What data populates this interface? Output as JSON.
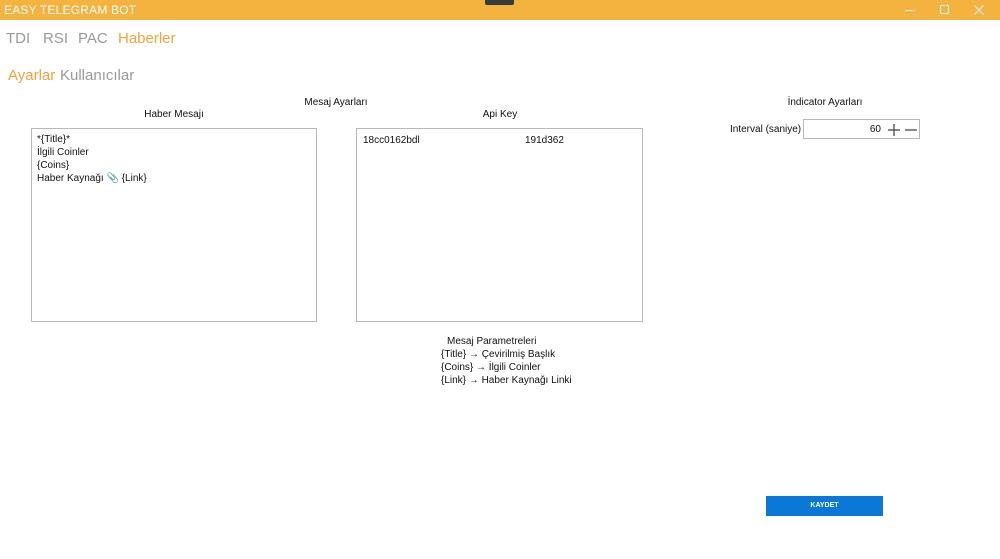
{
  "window": {
    "title": "EASY TELEGRAM BOT",
    "accent": "#f3b33e",
    "active_tab_color": "#f0a43a"
  },
  "tabs": [
    {
      "label": "TDI",
      "active": false
    },
    {
      "label": "RSI",
      "active": false
    },
    {
      "label": "PAC",
      "active": false
    },
    {
      "label": "Haberler",
      "active": true
    }
  ],
  "subtabs": [
    {
      "label": "Ayarlar",
      "active": true
    },
    {
      "label": "Kullanıcılar",
      "active": false
    }
  ],
  "message_settings": {
    "section_title": "Mesaj Ayarları",
    "news_message_label": "Haber Mesajı",
    "news_message_lines": [
      "*{Title}*",
      "İlgili Coinler",
      "{Coins}",
      "Haber Kaynağı 📎 {Link}"
    ],
    "api_key_label": "Api Key",
    "api_key_part1": "18cc0162bdl",
    "api_key_part2": "191d362"
  },
  "parameters": {
    "title": "Mesaj Parametreleri",
    "items": [
      "{Title} → Çevirilmiş Başlık",
      "{Coins} → İlgili Coinler",
      "{Link} → Haber Kaynağı Linki"
    ]
  },
  "indicator_settings": {
    "title": "İndicator Ayarları",
    "interval_label": "Interval (saniye)",
    "interval_value": "60"
  },
  "save_button": {
    "label": "KAYDET",
    "color": "#0a78d7"
  }
}
